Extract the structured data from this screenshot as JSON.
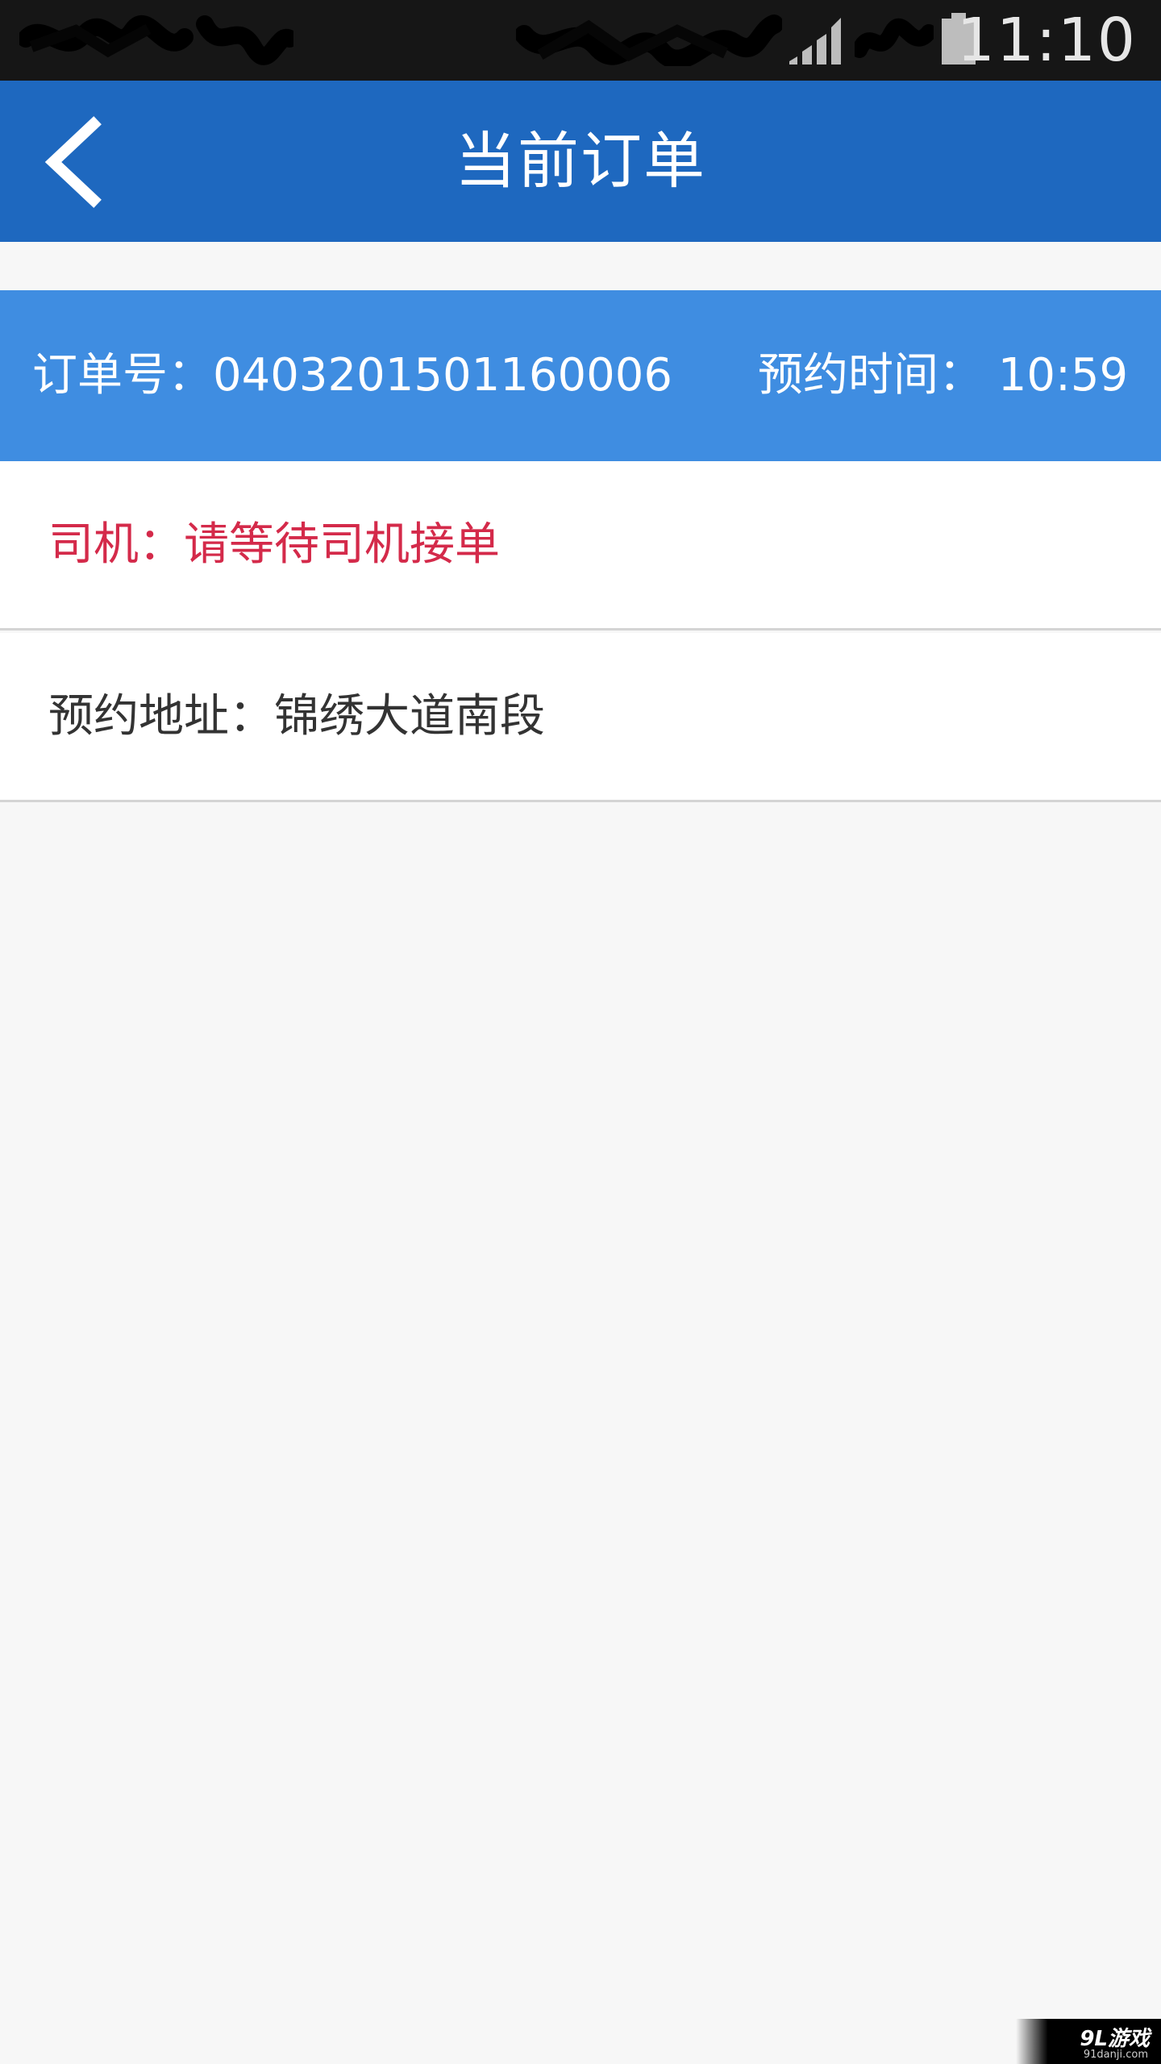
{
  "status_bar": {
    "time": "11:10",
    "icons": [
      "redacted-notification-icons",
      "signal-icon",
      "battery-icon"
    ]
  },
  "app_bar": {
    "back_icon": "chevron-left-icon",
    "title": "当前订单",
    "background_color": "#1e68bf"
  },
  "order": {
    "number_label": "订单号：0403201501160006",
    "time_label": "预约时间： 10:59",
    "header_color": "#3f8de1"
  },
  "driver": {
    "text": "司机：请等待司机接单",
    "color": "#d42a4a"
  },
  "address": {
    "text": "预约地址：锦绣大道南段"
  },
  "watermark": {
    "logo": "9L游戏",
    "url": "91danji.com"
  }
}
